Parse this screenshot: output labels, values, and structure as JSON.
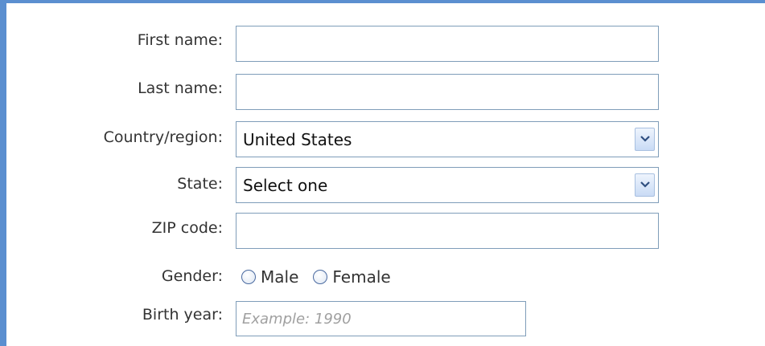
{
  "form": {
    "first_name": {
      "label": "First name:",
      "value": ""
    },
    "last_name": {
      "label": "Last name:",
      "value": ""
    },
    "country": {
      "label": "Country/region:",
      "selected": "United States"
    },
    "state": {
      "label": "State:",
      "selected": "Select one"
    },
    "zip": {
      "label": "ZIP code:",
      "value": ""
    },
    "gender": {
      "label": "Gender:",
      "options": [
        {
          "label": "Male",
          "checked": false
        },
        {
          "label": "Female",
          "checked": false
        }
      ]
    },
    "birth_year": {
      "label": "Birth year:",
      "placeholder": "Example: 1990"
    }
  },
  "colors": {
    "frame_border": "#5b8fd0",
    "field_border": "#7f9db9",
    "label_text": "#333333",
    "placeholder_text": "#a0a0a0"
  },
  "icons": {
    "dropdown": "chevron-down-icon",
    "radio": "radio-button-icon"
  }
}
